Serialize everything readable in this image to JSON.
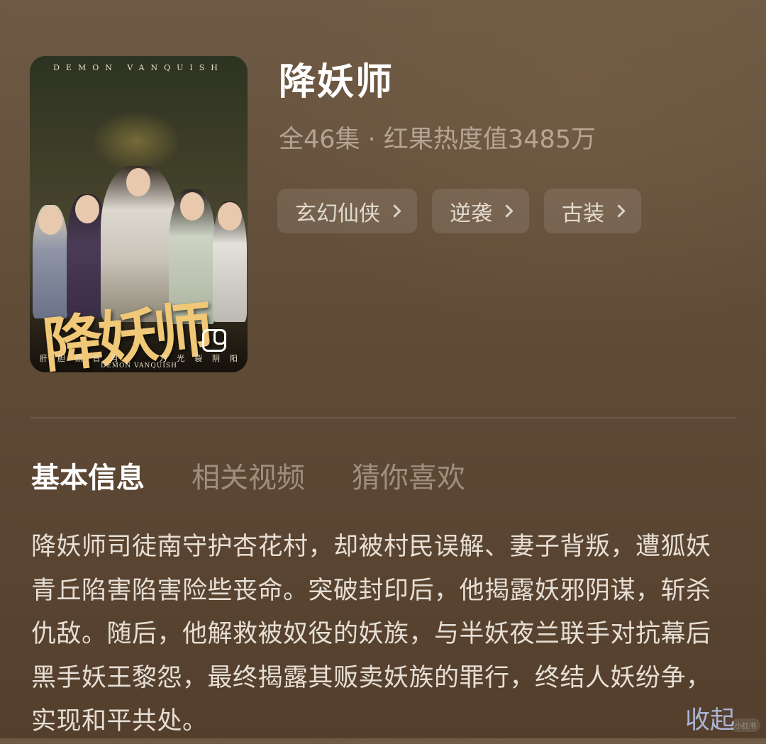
{
  "poster": {
    "top_text": "DEMON VANQUISH",
    "title_art": "降妖师",
    "subtitle_art": "DEMON VANQUISH",
    "bottom_text": [
      "肝",
      "胆",
      "照",
      "日",
      "月",
      "刀",
      "光",
      "裂",
      "阴",
      "阳"
    ],
    "overlay_icon": "picture-in-picture-icon"
  },
  "drama": {
    "title": "降妖师",
    "meta": "全46集 · 红果热度值3485万",
    "tags": [
      {
        "label": "玄幻仙侠",
        "icon": "chevron-right-icon"
      },
      {
        "label": "逆袭",
        "icon": "chevron-right-icon"
      },
      {
        "label": "古装",
        "icon": "chevron-right-icon"
      }
    ]
  },
  "tabs": [
    {
      "label": "基本信息",
      "active": true
    },
    {
      "label": "相关视频",
      "active": false
    },
    {
      "label": "猜你喜欢",
      "active": false
    }
  ],
  "description": "降妖师司徒南守护杏花村，却被村民误解、妻子背叛，遭狐妖青丘陷害陷害险些丧命。突破封印后，他揭露妖邪阴谋，斩杀仇敌。随后，他解救被奴役的妖族，与半妖夜兰联手对抗幕后黑手妖王黎怨，最终揭露其贩卖妖族的罪行，终结人妖纷争，实现和平共处。",
  "collapse_label": "收起",
  "watermark": "小红书",
  "colors": {
    "background": "#5f4b36",
    "accent_link": "#aab4d6",
    "poster_title": "#f0c877"
  }
}
